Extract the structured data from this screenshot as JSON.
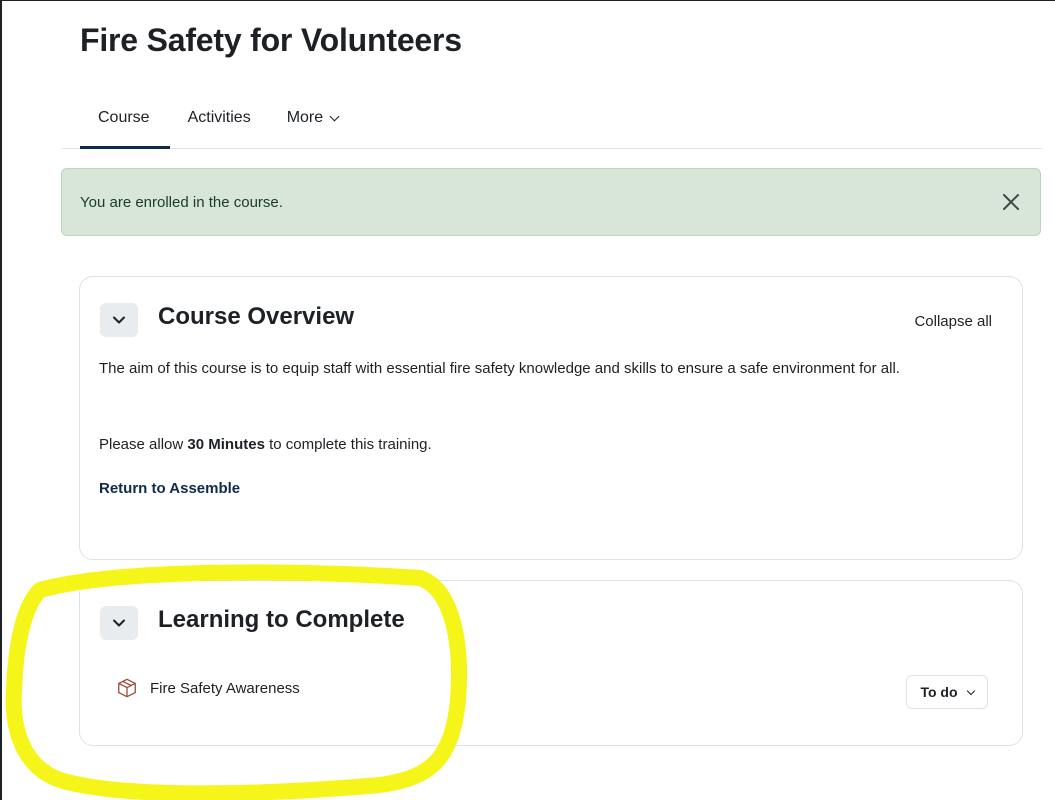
{
  "page": {
    "title": "Fire Safety for Volunteers"
  },
  "tabs": [
    {
      "label": "Course",
      "active": true
    },
    {
      "label": "Activities",
      "active": false
    },
    {
      "label": "More",
      "active": false
    }
  ],
  "alert": {
    "message": "You are enrolled in the course.",
    "close_icon": "close-icon"
  },
  "overview": {
    "title": "Course Overview",
    "collapse_label": "Collapse all",
    "summary_line": "The aim of this course is to equip staff with essential fire safety knowledge and skills to ensure a safe environment for all.",
    "allow_prefix": "Please allow ",
    "allow_bold": "30 Minutes",
    "allow_suffix": " to complete this training.",
    "return_link": "Return to Assemble"
  },
  "learning": {
    "title": "Learning to Complete",
    "activity": {
      "name": "Fire Safety Awareness",
      "icon": "package-icon",
      "status_label": "To do"
    }
  },
  "colors": {
    "alert_bg": "#d7e6d9",
    "tab_underline": "#0f2a4a",
    "activity_icon": "#9a4b36",
    "highlight": "#f5f51a"
  }
}
